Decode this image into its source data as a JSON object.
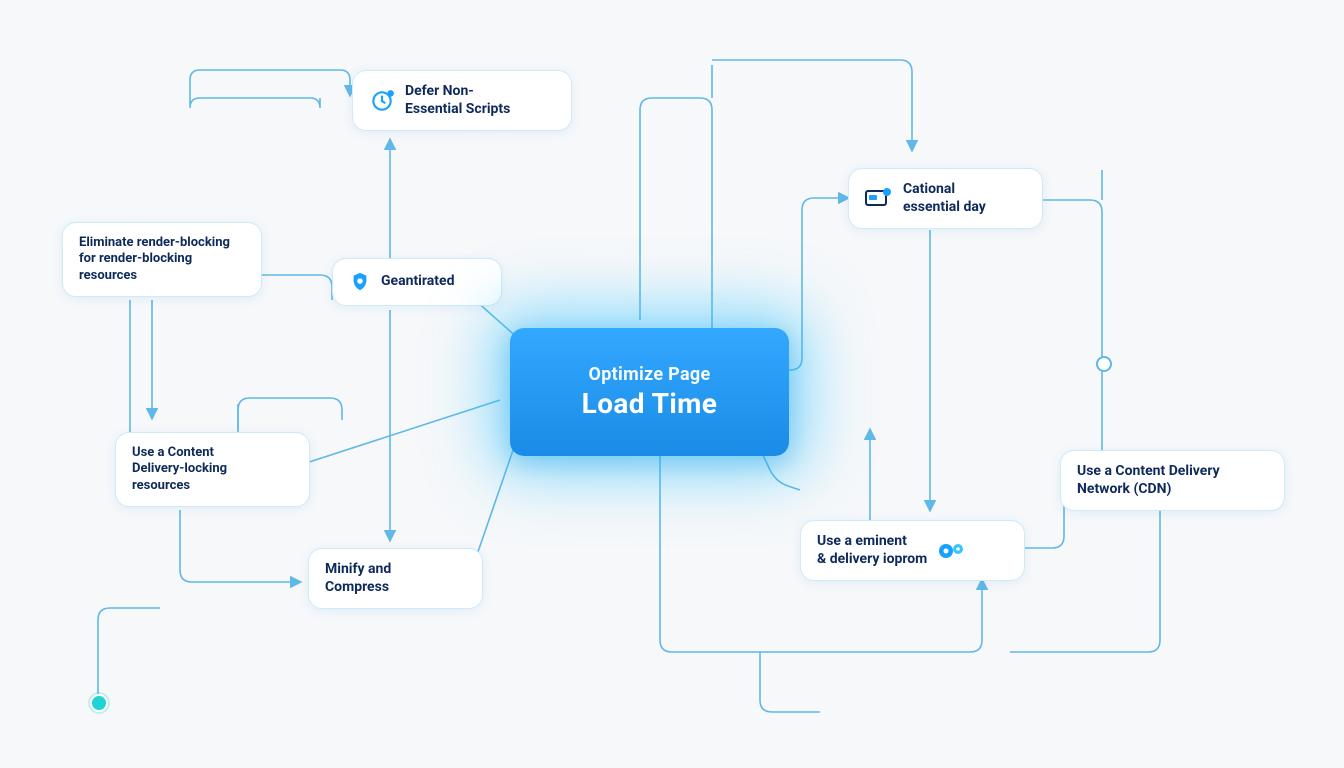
{
  "center": {
    "line1": "Optimize Page",
    "line2": "Load Time"
  },
  "nodes": {
    "defer": {
      "label": "Defer Non-\nEssential Scripts",
      "icon": "clock-gear"
    },
    "render": {
      "label": "Eliminate render-blocking\nfor render-blocking\nresources"
    },
    "geant": {
      "label": "Geantirated",
      "icon": "shield"
    },
    "usecont": {
      "label": "Use a Content\nDelivery-locking\nresources"
    },
    "minify": {
      "label": "Minify and\nCompress"
    },
    "cational": {
      "label": "Cational\nessential day",
      "icon": "screen-dot"
    },
    "usedel": {
      "label": "Use a eminent\n& delivery ioprom",
      "icon": "double-gear"
    },
    "cdn": {
      "label": "Use a Content Delivery\nNetwork (CDN)"
    }
  },
  "colors": {
    "accent": "#1aa0ff",
    "connector": "#60b8e8",
    "text": "#0e2a5a",
    "glow": "#38c5ff"
  }
}
